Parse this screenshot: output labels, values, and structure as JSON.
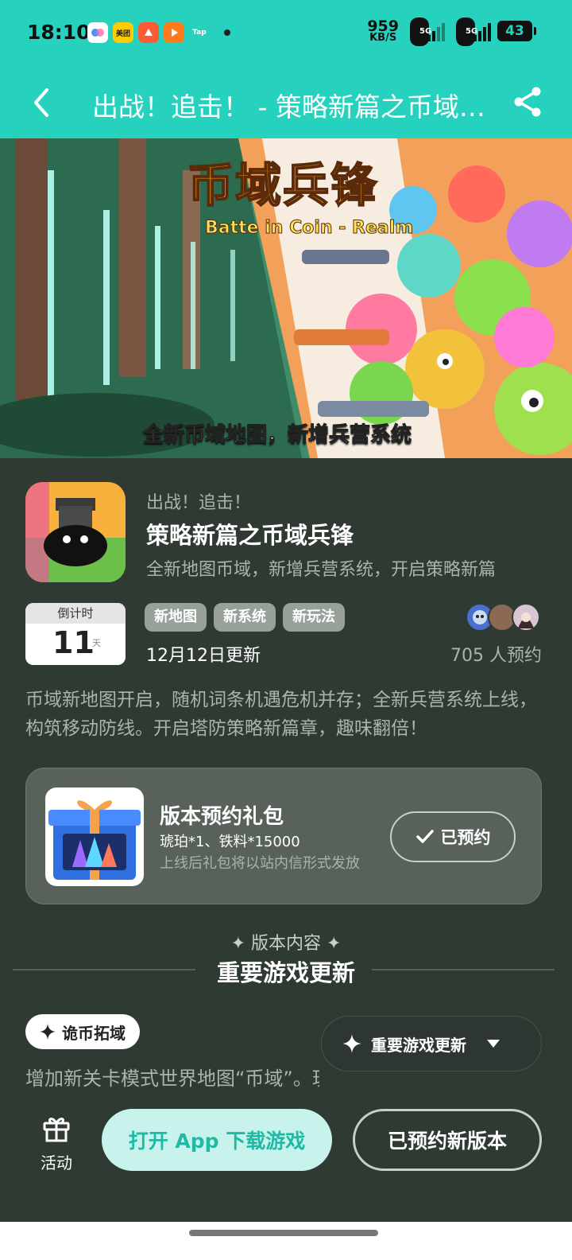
{
  "status_bar": {
    "time": "18:10",
    "apps": [
      {
        "name": "baidu-netdisk-icon",
        "label": "",
        "color": "#ffffff"
      },
      {
        "name": "meituan-icon",
        "label": "美团",
        "color": "#ffcc00"
      },
      {
        "name": "app-red-icon",
        "label": "",
        "color": "#ff5a36"
      },
      {
        "name": "video-app-icon",
        "label": "",
        "color": "#ff7a1a"
      },
      {
        "name": "taptap-icon",
        "label": "Tap",
        "color": "#26d2bd"
      }
    ],
    "net_speed_value": "959",
    "net_speed_unit": "KB/S",
    "signal_1": "5G",
    "signal_2": "5G",
    "battery": "43"
  },
  "header": {
    "title": "出战！追击！ - 策略新篇之币域兵锋"
  },
  "banner": {
    "logo_cn": "币域兵锋",
    "logo_en": "Batte in Coin - Realm",
    "caption": "全新币域地图，新增兵营系统"
  },
  "game": {
    "subtitle": "出战！追击！",
    "title": "策略新篇之币域兵锋",
    "description": "全新地图币域，新增兵营系统，开启策略新篇"
  },
  "countdown": {
    "label": "倒计时",
    "days": "11",
    "unit": "天"
  },
  "tags": [
    "新地图",
    "新系统",
    "新玩法"
  ],
  "update_date": "12月12日更新",
  "reserve_count": "705 人预约",
  "intro": "币域新地图开启，随机词条机遇危机并存；全新兵营系统上线，构筑移动防线。开启塔防策略新篇章，趣味翻倍！",
  "gift": {
    "title": "版本预约礼包",
    "items": "琥珀*1、铁料*15000",
    "note": "上线后礼包将以站内信形式发放",
    "button": "已预约"
  },
  "section": {
    "kicker": "✦ 版本内容 ✦",
    "title": "重要游戏更新"
  },
  "content": {
    "tag": "诡币拓域",
    "line": "增加新关卡模式世界地图“币域”。玩家可以使用诡币",
    "selector": "重要游戏更新"
  },
  "bottom": {
    "activity_label": "活动",
    "open_app": "打开 App 下载游戏",
    "reserved_version": "已预约新版本"
  },
  "colors": {
    "accent": "#26d2bd",
    "background": "#2f3a33"
  }
}
